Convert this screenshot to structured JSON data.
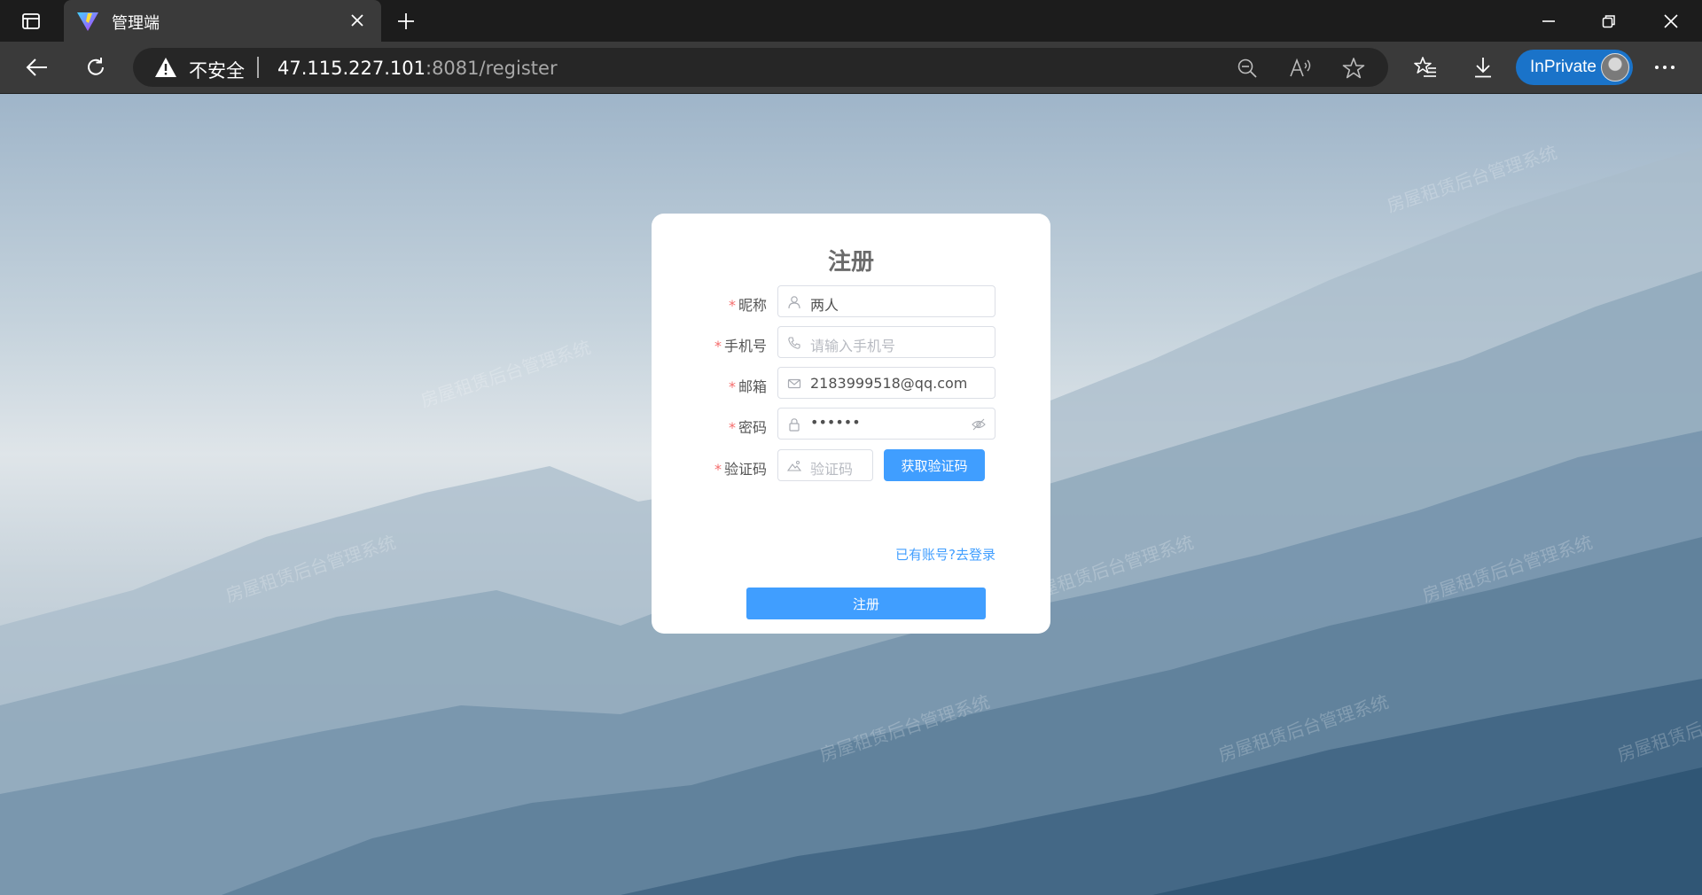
{
  "browser": {
    "tab_title": "管理端",
    "address": {
      "security_label": "不安全",
      "url_host": "47.115.227.101",
      "url_rest": ":8081/register"
    },
    "inprivate_label": "InPrivate"
  },
  "form": {
    "title": "注册",
    "required_mark": "*",
    "fields": [
      {
        "label": "昵称",
        "value": "两人",
        "placeholder": "",
        "icon": "user-icon"
      },
      {
        "label": "手机号",
        "value": "",
        "placeholder": "请输入手机号",
        "icon": "phone-icon"
      },
      {
        "label": "邮箱",
        "value": "2183999518@qq.com",
        "placeholder": "",
        "icon": "mail-icon"
      },
      {
        "label": "密码",
        "value": "••••••",
        "placeholder": "",
        "icon": "lock-icon"
      },
      {
        "label": "验证码",
        "value": "",
        "placeholder": "验证码",
        "icon": "image-icon"
      }
    ],
    "get_code_label": "获取验证码",
    "login_link": "已有账号?去登录",
    "submit_label": "注册"
  },
  "watermark_text": "房屋租赁后台管理系统",
  "colors": {
    "primary": "#409eff",
    "required": "#f56c6c",
    "inprivate": "#1a73c9"
  }
}
